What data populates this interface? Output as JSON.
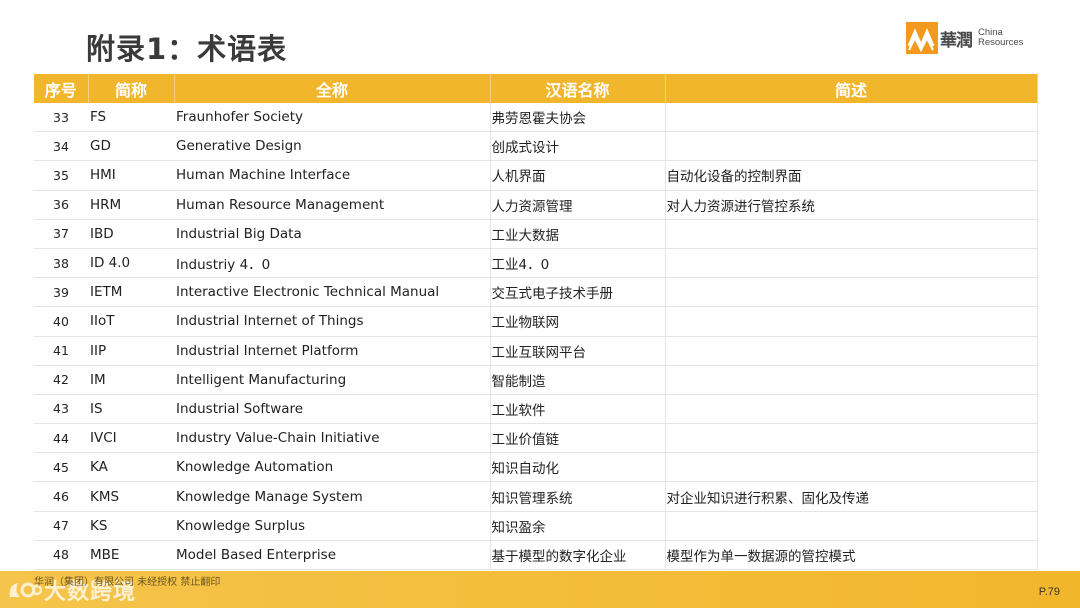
{
  "slide": {
    "title": "附录1：术语表",
    "page_number": "P.79"
  },
  "logo": {
    "chinese": "華潤",
    "english_line1": "China",
    "english_line2": "Resources"
  },
  "table": {
    "headers": [
      "序号",
      "简称",
      "全称",
      "汉语名称",
      "简述"
    ],
    "rows": [
      [
        "33",
        "FS",
        "Fraunhofer Society",
        "弗劳恩霍夫协会",
        ""
      ],
      [
        "34",
        "GD",
        "Generative Design",
        "创成式设计",
        ""
      ],
      [
        "35",
        "HMI",
        "Human Machine Interface",
        "人机界面",
        "自动化设备的控制界面"
      ],
      [
        "36",
        "HRM",
        "Human Resource Management",
        "人力资源管理",
        "对人力资源进行管控系统"
      ],
      [
        "37",
        "IBD",
        "Industrial Big Data",
        "工业大数据",
        ""
      ],
      [
        "38",
        "ID 4.0",
        "Industriy 4．0",
        "工业4．0",
        ""
      ],
      [
        "39",
        "IETM",
        "Interactive Electronic Technical Manual",
        "交互式电子技术手册",
        ""
      ],
      [
        "40",
        "IIoT",
        "Industrial Internet of Things",
        "工业物联网",
        ""
      ],
      [
        "41",
        "IIP",
        "Industrial Internet Platform",
        "工业互联网平台",
        ""
      ],
      [
        "42",
        "IM",
        "Intelligent Manufacturing",
        "智能制造",
        ""
      ],
      [
        "43",
        "IS",
        "Industrial Software",
        "工业软件",
        ""
      ],
      [
        "44",
        "IVCI",
        "Industry Value-Chain Initiative",
        "工业价值链",
        ""
      ],
      [
        "45",
        "KA",
        "Knowledge Automation",
        "知识自动化",
        ""
      ],
      [
        "46",
        "KMS",
        "Knowledge Manage System",
        "知识管理系统",
        "对企业知识进行积累、固化及传递"
      ],
      [
        "47",
        "KS",
        "Knowledge Surplus",
        "知识盈余",
        ""
      ],
      [
        "48",
        "MBE",
        "Model Based Enterprise",
        "基于模型的数字化企业",
        "模型作为单一数据源的管控模式"
      ]
    ]
  },
  "footer": {
    "note": "华润（集团）有限公司 未经授权 禁止翻印",
    "watermark": "大数跨境"
  },
  "colors": {
    "accent": "#f2b62c",
    "logo_orange": "#f39a1e"
  }
}
